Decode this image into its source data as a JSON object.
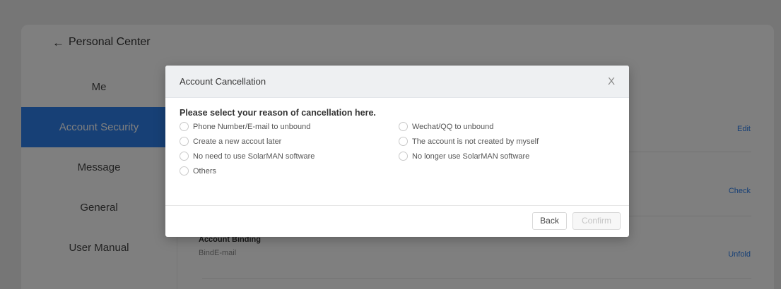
{
  "app": {
    "back_label": "Personal Center",
    "nav": [
      {
        "label": "Me"
      },
      {
        "label": "Account Security",
        "active": true
      },
      {
        "label": "Message"
      },
      {
        "label": "General"
      },
      {
        "label": "User Manual"
      }
    ]
  },
  "content": {
    "edit_label": "Edit",
    "check_label": "Check",
    "binding_title": "Account Binding",
    "binding_sub": "BindE-mail",
    "unfold_label": "Unfold"
  },
  "modal": {
    "title": "Account Cancellation",
    "close": "X",
    "prompt": "Please select your reason of cancellation here.",
    "options": [
      "Phone Number/E-mail to unbound",
      "Wechat/QQ to unbound",
      "Create a new accout later",
      "The account is not created by myself",
      "No need to use SolarMAN software",
      "No longer use SolarMAN software",
      "Others"
    ],
    "back_button": "Back",
    "confirm_button": "Confirm"
  },
  "colors": {
    "accent": "#2f80ed",
    "overlay": "rgba(0,0,0,0.5)",
    "modal_header": "#eef0f2"
  }
}
